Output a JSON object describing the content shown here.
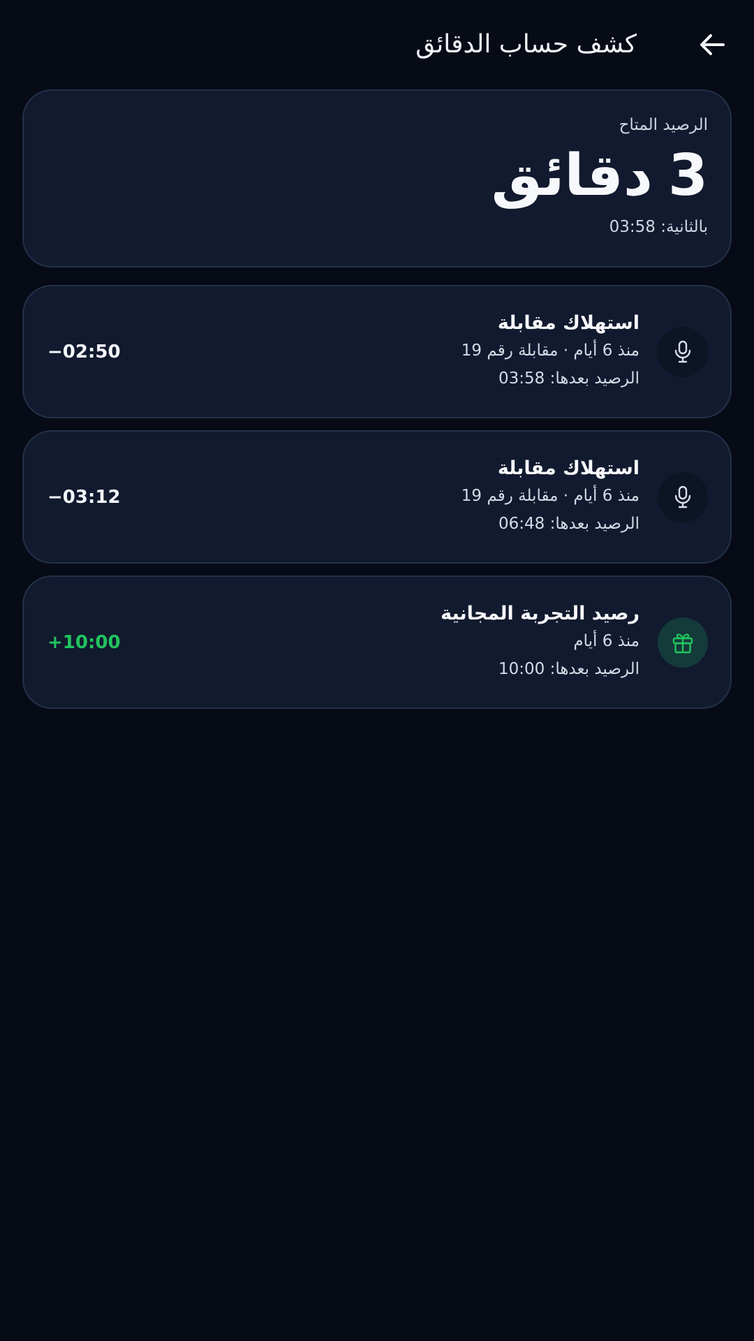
{
  "header": {
    "title": "كشف حساب الدقائق",
    "back_icon": "arrow-left-icon"
  },
  "balance": {
    "label": "الرصيد المتاح",
    "amount_value": "3",
    "amount_unit": "دقائق",
    "seconds_text": "بالثانية: 03:58"
  },
  "colors": {
    "background": "#060b16",
    "card": "#111a2e",
    "positive": "#22c45e",
    "gift_icon_bg": "#143a3a"
  },
  "transactions": [
    {
      "icon": "microphone-icon",
      "title": "استهلاك مقابلة",
      "detail": "منذ 6 أيام · مقابلة رقم 19",
      "balance_after": "الرصيد بعدها: 03:58",
      "amount": "−02:50",
      "sign": "negative"
    },
    {
      "icon": "microphone-icon",
      "title": "استهلاك مقابلة",
      "detail": "منذ 6 أيام · مقابلة رقم 19",
      "balance_after": "الرصيد بعدها: 06:48",
      "amount": "−03:12",
      "sign": "negative"
    },
    {
      "icon": "gift-icon",
      "title": "رصيد التجربة المجانية",
      "detail": "منذ 6 أيام",
      "balance_after": "الرصيد بعدها: 10:00",
      "amount": "+10:00",
      "sign": "positive"
    }
  ]
}
